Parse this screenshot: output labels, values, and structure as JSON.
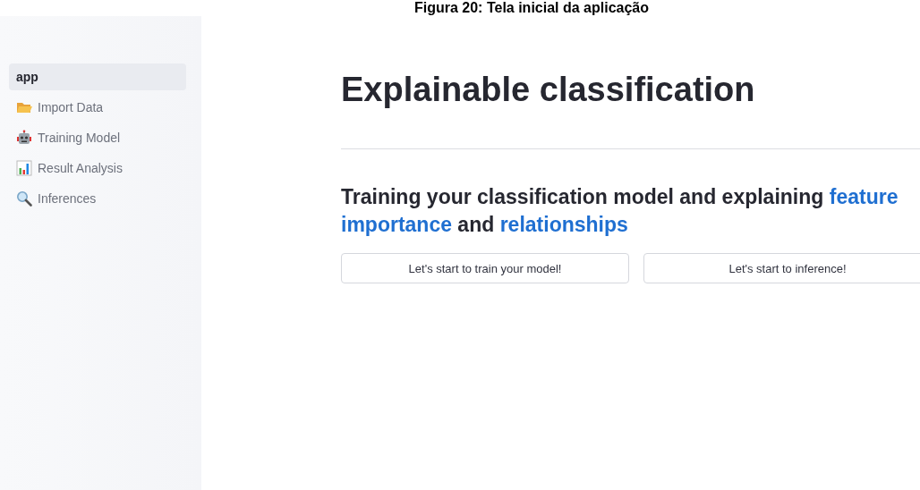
{
  "caption": "Figura 20: Tela inicial da aplicação",
  "sidebar": {
    "items": [
      {
        "label": "app",
        "selected": true
      },
      {
        "label": "Import Data",
        "selected": false
      },
      {
        "label": "Training Model",
        "selected": false
      },
      {
        "label": "Result Analysis",
        "selected": false
      },
      {
        "label": "Inferences",
        "selected": false
      }
    ]
  },
  "main": {
    "title": "Explainable classification",
    "subtitle": [
      {
        "text": "Training your classification model and explaining ",
        "highlight": false
      },
      {
        "text": "feature importance",
        "highlight": true
      },
      {
        "text": " and ",
        "highlight": false
      },
      {
        "text": "relationships",
        "highlight": true
      }
    ],
    "buttons": [
      "Let's start to train your model!",
      "Let's start to inference!"
    ]
  }
}
